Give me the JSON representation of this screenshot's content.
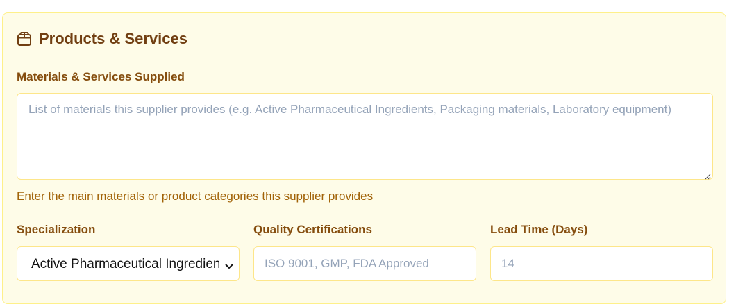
{
  "section": {
    "title": "Products & Services",
    "icon": "package-icon"
  },
  "materials": {
    "label": "Materials & Services Supplied",
    "placeholder": "List of materials this supplier provides (e.g. Active Pharmaceutical Ingredients, Packaging materials, Laboratory equipment)",
    "value": "",
    "help": "Enter the main materials or product categories this supplier provides"
  },
  "specialization": {
    "label": "Specialization",
    "selected": "Active Pharmaceutical Ingredients"
  },
  "certifications": {
    "label": "Quality Certifications",
    "placeholder": "ISO 9001, GMP, FDA Approved",
    "value": ""
  },
  "lead_time": {
    "label": "Lead Time (Days)",
    "placeholder": "14",
    "value": ""
  },
  "colors": {
    "card_bg": "#fefce8",
    "card_border": "#fef08a",
    "title": "#713f12",
    "label": "#854d0e",
    "help": "#a16207",
    "placeholder": "#94a3b8"
  }
}
